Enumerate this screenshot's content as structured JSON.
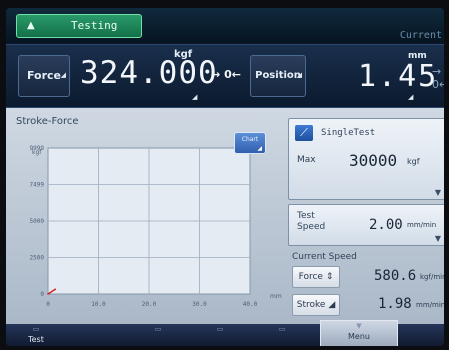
{
  "status": {
    "tab_label": "Testing",
    "right_label": "Current"
  },
  "readout": {
    "force_label": "Force",
    "force_value": "324.000",
    "force_unit": "kgf",
    "zero_label": "→ 0←",
    "position_label": "Position",
    "position_value": "1.45",
    "position_unit": "mm"
  },
  "graph": {
    "title": "Stroke-Force",
    "chart_button": "Chart"
  },
  "chart_data": {
    "type": "line",
    "title": "Stroke-Force",
    "xlabel": "mm",
    "ylabel": "kgf",
    "xlim": [
      0,
      40
    ],
    "ylim": [
      0,
      10000
    ],
    "x_ticks": [
      "0",
      "10.0",
      "20.0",
      "30.0",
      "40.0"
    ],
    "y_ticks": [
      "0",
      "2500",
      "5000",
      "7499",
      "9999"
    ],
    "grid": true,
    "series": [
      {
        "x": [
          0,
          1.45
        ],
        "y": [
          0,
          324
        ]
      }
    ]
  },
  "test": {
    "name": "SingleTest",
    "max_label": "Max",
    "max_value": "30000",
    "max_unit": "kgf"
  },
  "speed": {
    "label": "Test Speed",
    "value": "2.00",
    "unit": "mm/min"
  },
  "current_speed": {
    "label": "Current Speed",
    "force_button": "Force",
    "force_value": "580.6",
    "force_unit": "kgf/min",
    "stroke_button": "Stroke",
    "stroke_value": "1.98",
    "stroke_unit": "mm/min"
  },
  "nav": {
    "test": "Test",
    "last": "Menu"
  },
  "colors": {
    "accent": "#137048",
    "panel": "#cfd8e2",
    "bar": "#0b1a2e"
  }
}
